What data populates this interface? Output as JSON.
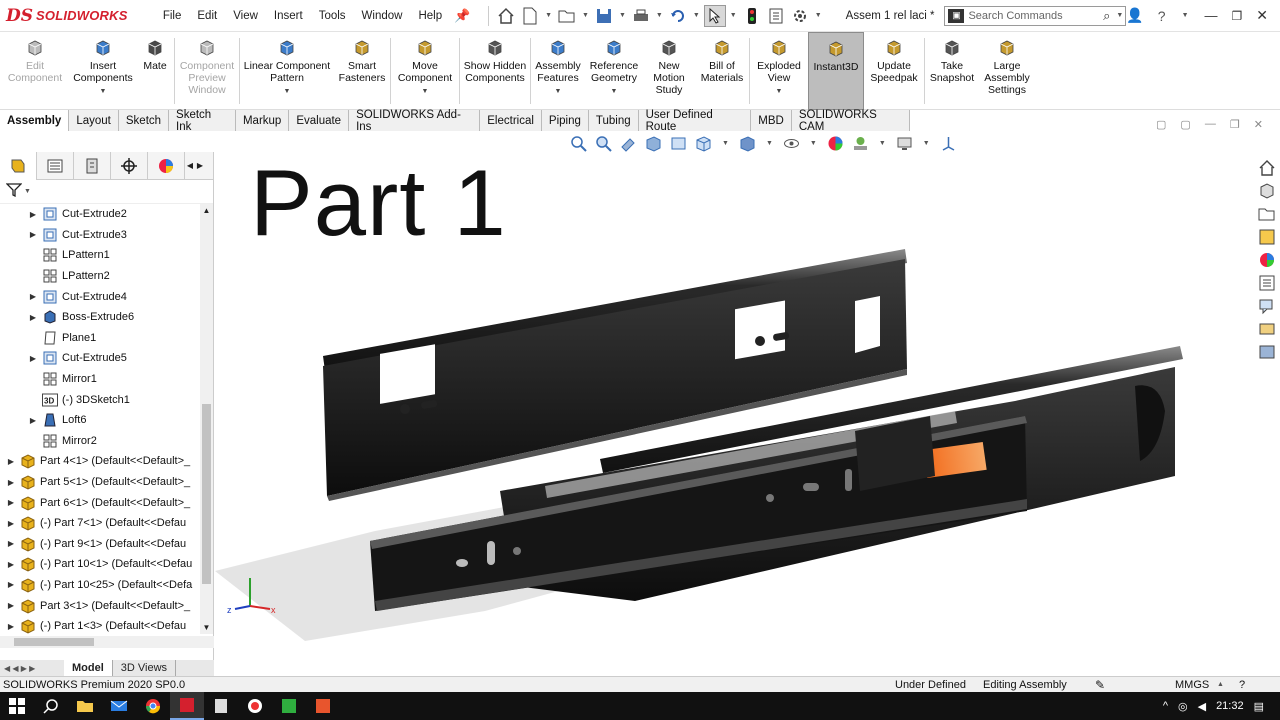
{
  "app": {
    "brand": "SOLIDWORKS",
    "doc_title": "Assem 1 rel laci *"
  },
  "menu": [
    "File",
    "Edit",
    "View",
    "Insert",
    "Tools",
    "Window",
    "Help"
  ],
  "search": {
    "placeholder": "Search Commands"
  },
  "commands": [
    {
      "label": "Edit Component",
      "icon": "edit-component-icon",
      "disabled": true
    },
    {
      "label": "Insert Components",
      "icon": "insert-components-icon",
      "disabled": false
    },
    {
      "label": "Mate",
      "icon": "mate-icon",
      "disabled": false
    },
    {
      "label": "Component Preview Window",
      "icon": "component-preview-icon",
      "disabled": true
    },
    {
      "label": "Linear Component Pattern",
      "icon": "linear-pattern-icon",
      "disabled": false
    },
    {
      "label": "Smart Fasteners",
      "icon": "smart-fasteners-icon",
      "disabled": false
    },
    {
      "label": "Move Component",
      "icon": "move-component-icon",
      "disabled": false
    },
    {
      "label": "Show Hidden Components",
      "icon": "show-hidden-icon",
      "disabled": false
    },
    {
      "label": "Assembly Features",
      "icon": "assembly-features-icon",
      "disabled": false
    },
    {
      "label": "Reference Geometry",
      "icon": "reference-geometry-icon",
      "disabled": false
    },
    {
      "label": "New Motion Study",
      "icon": "motion-study-icon",
      "disabled": false
    },
    {
      "label": "Bill of Materials",
      "icon": "bom-icon",
      "disabled": false
    },
    {
      "label": "Exploded View",
      "icon": "exploded-view-icon",
      "disabled": false
    },
    {
      "label": "Instant3D",
      "icon": "instant3d-icon",
      "disabled": false
    },
    {
      "label": "Update Speedpak",
      "icon": "speedpak-icon",
      "disabled": false
    },
    {
      "label": "Take Snapshot",
      "icon": "snapshot-icon",
      "disabled": false
    },
    {
      "label": "Large Assembly Settings",
      "icon": "large-assembly-icon",
      "disabled": false
    }
  ],
  "tabs": [
    "Assembly",
    "Layout",
    "Sketch",
    "Sketch Ink",
    "Markup",
    "Evaluate",
    "SOLIDWORKS Add-Ins",
    "Electrical",
    "Piping",
    "Tubing",
    "User Defined Route",
    "MBD",
    "SOLIDWORKS CAM"
  ],
  "active_tab": "Assembly",
  "tree": [
    {
      "label": "Cut-Extrude2",
      "type": "cut",
      "expand": true,
      "indent": 1
    },
    {
      "label": "Cut-Extrude3",
      "type": "cut",
      "expand": true,
      "indent": 1
    },
    {
      "label": "LPattern1",
      "type": "pattern",
      "expand": false,
      "indent": 1
    },
    {
      "label": "LPattern2",
      "type": "pattern",
      "expand": false,
      "indent": 1
    },
    {
      "label": "Cut-Extrude4",
      "type": "cut",
      "expand": true,
      "indent": 1
    },
    {
      "label": "Boss-Extrude6",
      "type": "boss",
      "expand": true,
      "indent": 1
    },
    {
      "label": "Plane1",
      "type": "plane",
      "expand": false,
      "indent": 1
    },
    {
      "label": "Cut-Extrude5",
      "type": "cut",
      "expand": true,
      "indent": 1
    },
    {
      "label": "Mirror1",
      "type": "pattern",
      "expand": false,
      "indent": 1
    },
    {
      "label": "(-) 3DSketch1",
      "type": "sketch3d",
      "expand": false,
      "indent": 1
    },
    {
      "label": "Loft6",
      "type": "loft",
      "expand": true,
      "indent": 1
    },
    {
      "label": "Mirror2",
      "type": "pattern",
      "expand": false,
      "indent": 1
    },
    {
      "label": "Part 4<1> (Default<<Default>_",
      "type": "part",
      "expand": true,
      "indent": 0
    },
    {
      "label": "Part 5<1> (Default<<Default>_",
      "type": "part",
      "expand": true,
      "indent": 0
    },
    {
      "label": "Part 6<1> (Default<<Default>_",
      "type": "part",
      "expand": true,
      "indent": 0
    },
    {
      "label": "(-) Part 7<1> (Default<<Defau",
      "type": "part",
      "expand": true,
      "indent": 0
    },
    {
      "label": "(-) Part 9<1> (Default<<Defau",
      "type": "part",
      "expand": true,
      "indent": 0
    },
    {
      "label": "(-) Part 10<1> (Default<<Defau",
      "type": "part",
      "expand": true,
      "indent": 0
    },
    {
      "label": "(-) Part 10<25> (Default<<Defa",
      "type": "part",
      "expand": true,
      "indent": 0
    },
    {
      "label": "Part 3<1> (Default<<Default>_",
      "type": "part",
      "expand": true,
      "indent": 0
    },
    {
      "label": "(-) Part 1<3> (Default<<Defau",
      "type": "part",
      "expand": true,
      "indent": 0
    }
  ],
  "bottom_tabs": [
    "Model",
    "3D Views"
  ],
  "overlay": {
    "part_title": "Part 1"
  },
  "status": {
    "product": "SOLIDWORKS Premium 2020 SP0.0",
    "definition": "Under Defined",
    "mode": "Editing Assembly",
    "units": "MMGS"
  },
  "taskbar": {
    "time": "21:32"
  },
  "colors": {
    "brand_red": "#d4202e",
    "part_icon_yellow": "#e8b21c",
    "rail_dark": "#1a1a1a",
    "tab_orange": "#f07a2a"
  }
}
